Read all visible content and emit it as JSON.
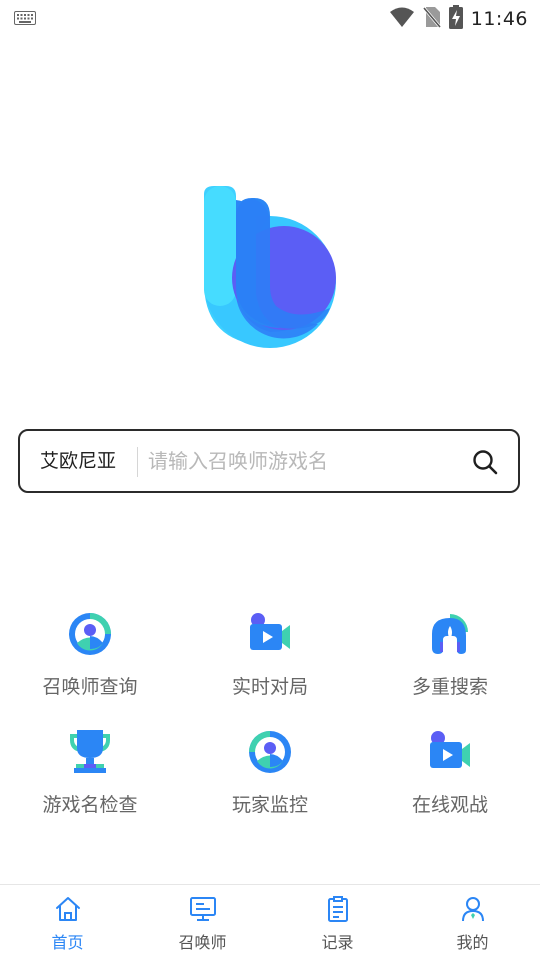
{
  "status_bar": {
    "time": "11:46",
    "icons": [
      "keyboard-icon",
      "wifi-icon",
      "no-sim-icon",
      "battery-charging-icon"
    ]
  },
  "search": {
    "region": "艾欧尼亚",
    "placeholder": "请输入召唤师游戏名",
    "value": ""
  },
  "features": [
    {
      "label": "召唤师查询",
      "icon": "user-circle-icon"
    },
    {
      "label": "实时对局",
      "icon": "video-camera-icon"
    },
    {
      "label": "多重搜索",
      "icon": "helmet-icon"
    },
    {
      "label": "游戏名检查",
      "icon": "trophy-icon"
    },
    {
      "label": "玩家监控",
      "icon": "user-circle-icon"
    },
    {
      "label": "在线观战",
      "icon": "video-camera-icon"
    }
  ],
  "tabs": [
    {
      "label": "首页",
      "icon": "home-icon",
      "active": true
    },
    {
      "label": "召唤师",
      "icon": "monitor-icon",
      "active": false
    },
    {
      "label": "记录",
      "icon": "clipboard-icon",
      "active": false
    },
    {
      "label": "我的",
      "icon": "person-icon",
      "active": false
    }
  ],
  "colors": {
    "accent": "#2b86f5",
    "teal": "#3fd1b0",
    "indigo": "#5b5ef5",
    "cyan": "#3ed0ff"
  }
}
